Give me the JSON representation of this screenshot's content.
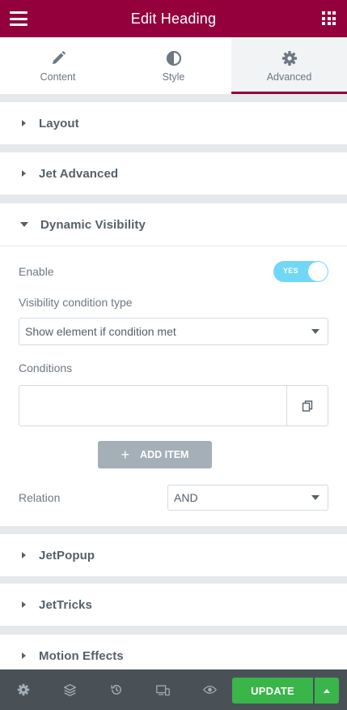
{
  "header": {
    "title": "Edit Heading",
    "menu_icon": "hamburger-icon",
    "apps_icon": "grid-icon",
    "color": "#93003c"
  },
  "tabs": [
    {
      "label": "Content",
      "icon": "pencil-icon"
    },
    {
      "label": "Style",
      "icon": "half-circle-icon"
    },
    {
      "label": "Advanced",
      "icon": "gear-icon",
      "active": true
    }
  ],
  "sections": {
    "layout": {
      "title": "Layout"
    },
    "jet_advanced": {
      "title": "Jet Advanced"
    },
    "dynamic_visibility": {
      "title": "Dynamic Visibility",
      "enable_label": "Enable",
      "enable_toggle_text": "YES",
      "condition_type_label": "Visibility condition type",
      "condition_type_value": "Show element if condition met",
      "conditions_label": "Conditions",
      "add_item_label": "ADD ITEM",
      "relation_label": "Relation",
      "relation_value": "AND"
    },
    "jetpopup": {
      "title": "JetPopup"
    },
    "jettricks": {
      "title": "JetTricks"
    },
    "motion_effects": {
      "title": "Motion Effects"
    }
  },
  "footer": {
    "icons": [
      "settings-icon",
      "layers-icon",
      "history-icon",
      "responsive-icon",
      "preview-icon"
    ],
    "update_label": "UPDATE",
    "update_color": "#39b54a"
  }
}
